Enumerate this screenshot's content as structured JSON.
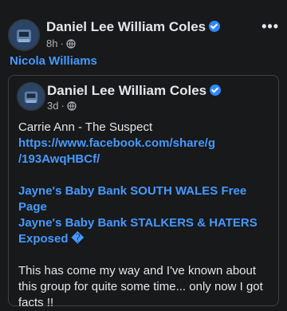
{
  "post": {
    "author": "Daniel Lee William Coles",
    "time": "8h",
    "audience_icon": "globe-icon",
    "more_label": "•••",
    "tagged_user": "Nicola Williams"
  },
  "shared_post": {
    "author": "Daniel Lee William Coles",
    "time": "3d",
    "audience_icon": "globe-icon",
    "line1": "Carrie Ann - The Suspect",
    "link_line1": "https://www.facebook.com/share/g",
    "link_line2": "/193AwqHBCf/",
    "group_line1": "Jayne's Baby Bank SOUTH WALES Free Page",
    "group_line2": "Jayne's Baby Bank STALKERS & HATERS",
    "group_line3": "Exposed �",
    "text_line1": "This has come my way and I've known about",
    "text_line2": "this group for quite some time... only now I got",
    "text_line3": "facts !!"
  },
  "colors": {
    "background": "#18191a",
    "link": "#4599ff",
    "verified": "#2d88ff",
    "meta": "#b0b3b8"
  }
}
